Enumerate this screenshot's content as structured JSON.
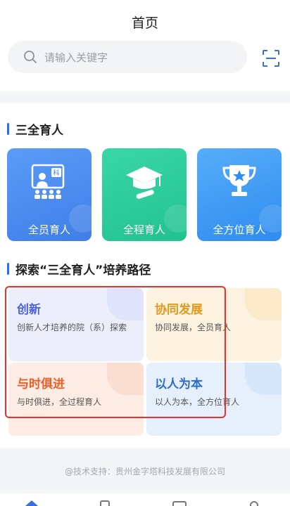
{
  "header": {
    "title": "首页"
  },
  "search": {
    "placeholder": "请输入关键字"
  },
  "section1": {
    "title": "三全育人"
  },
  "tiles": [
    {
      "label": "全员育人",
      "color": "#4a8ef2"
    },
    {
      "label": "全程育人",
      "color": "#2fcf9d"
    },
    {
      "label": "全方位育人",
      "color": "#3c9cf5"
    }
  ],
  "section2": {
    "title": "探索“三全育人”培养路径"
  },
  "cards": [
    {
      "title": "创新",
      "desc": "创新人才培养的院（系）探索",
      "title_color": "#4d63d8",
      "bg": "#eceefc"
    },
    {
      "title": "协同发展",
      "desc": "协同发展，全员育人",
      "title_color": "#e29a1c",
      "bg": "#fdf3e0"
    },
    {
      "title": "与时俱进",
      "desc": "与时俱进，全过程育人",
      "title_color": "#e5622a",
      "bg": "#fdece4"
    },
    {
      "title": "以人为本",
      "desc": "以人为本，全方位育人",
      "title_color": "#2f6bc8",
      "bg": "#e5f0fc"
    }
  ],
  "footer": {
    "text": "@技术支持：贵州金字塔科技发展有限公司"
  },
  "highlight_color": "#e8312b",
  "tile_badge": "科"
}
